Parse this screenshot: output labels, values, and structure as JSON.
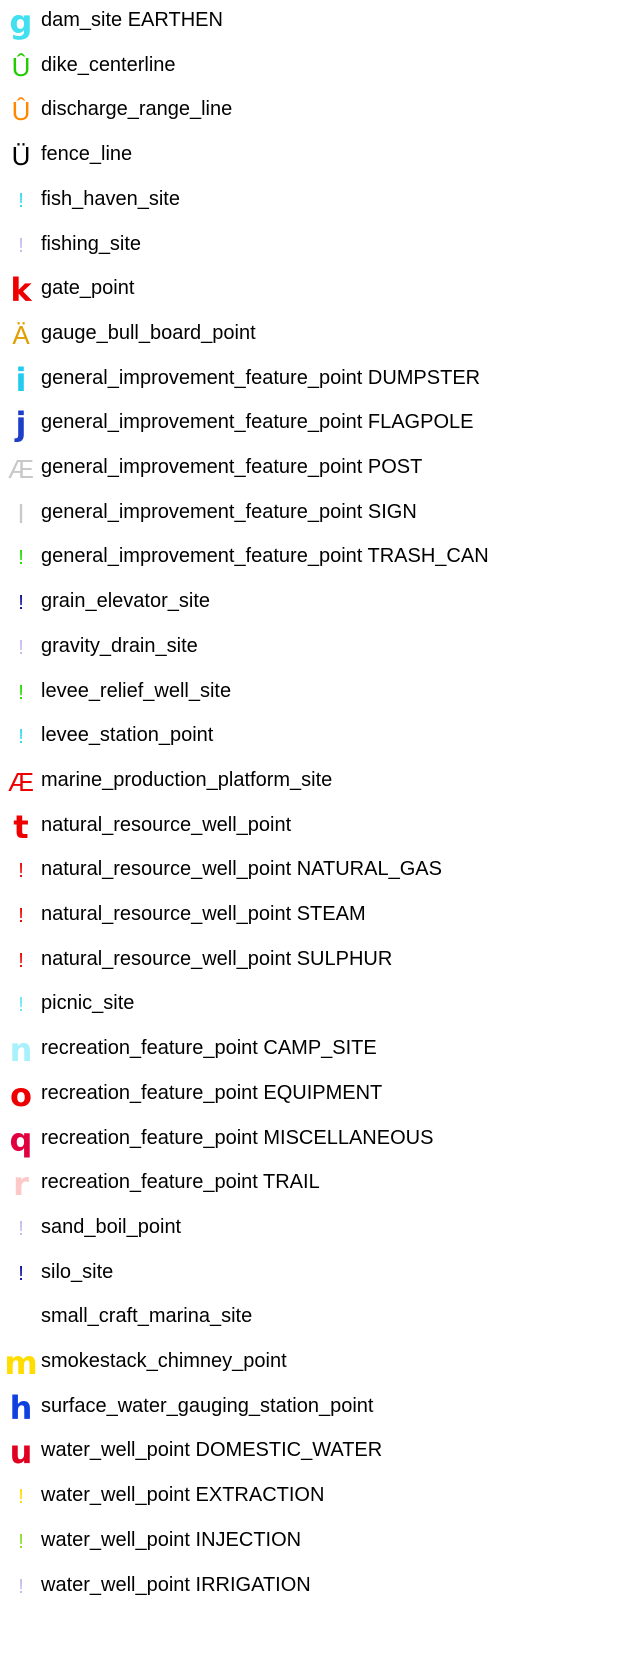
{
  "legend": {
    "items": [
      {
        "symbol": "g",
        "color": "#40e0f0",
        "label": "dam_site EARTHEN"
      },
      {
        "symbol": "Û",
        "color": "#22cc00",
        "label": "dike_centerline"
      },
      {
        "symbol": "Û",
        "color": "#ff8800",
        "label": "discharge_range_line"
      },
      {
        "symbol": "Ü",
        "color": "#000000",
        "label": "fence_line"
      },
      {
        "symbol": "!",
        "color": "#33ddee",
        "label": "fish_haven_site"
      },
      {
        "symbol": "!",
        "color": "#c8b8ee",
        "label": "fishing_site"
      },
      {
        "symbol": "k",
        "color": "#ee0000",
        "label": "gate_point"
      },
      {
        "symbol": "Ä",
        "color": "#e0a000",
        "label": "gauge_bull_board_point"
      },
      {
        "symbol": "i",
        "color": "#22ccee",
        "label": "general_improvement_feature_point DUMPSTER"
      },
      {
        "symbol": "j",
        "color": "#1e3ec8",
        "label": "general_improvement_feature_point FLAGPOLE"
      },
      {
        "symbol": "Æ",
        "color": "#c8c8c8",
        "label": "general_improvement_feature_point POST"
      },
      {
        "symbol": "l",
        "color": "#c8c8c8",
        "label": "general_improvement_feature_point SIGN"
      },
      {
        "symbol": "!",
        "color": "#22dd00",
        "label": "general_improvement_feature_point TRASH_CAN"
      },
      {
        "symbol": "!",
        "color": "#0a0a9c",
        "label": "grain_elevator_site"
      },
      {
        "symbol": "!",
        "color": "#c8b8ee",
        "label": "gravity_drain_site"
      },
      {
        "symbol": "!",
        "color": "#22dd00",
        "label": "levee_relief_well_site"
      },
      {
        "symbol": "!",
        "color": "#33ddee",
        "label": "levee_station_point"
      },
      {
        "symbol": "Æ",
        "color": "#ee0000",
        "label": "marine_production_platform_site"
      },
      {
        "symbol": "t",
        "color": "#ee0000",
        "label": "natural_resource_well_point"
      },
      {
        "symbol": "!",
        "color": "#ee0000",
        "label": "natural_resource_well_point NATURAL_GAS"
      },
      {
        "symbol": "!",
        "color": "#ee0000",
        "label": "natural_resource_well_point STEAM"
      },
      {
        "symbol": "!",
        "color": "#ee0000",
        "label": "natural_resource_well_point SULPHUR"
      },
      {
        "symbol": "!",
        "color": "#66e8f4",
        "label": "picnic_site"
      },
      {
        "symbol": "n",
        "color": "#a8f0fc",
        "label": "recreation_feature_point CAMP_SITE"
      },
      {
        "symbol": "o",
        "color": "#ee0000",
        "label": "recreation_feature_point EQUIPMENT"
      },
      {
        "symbol": "q",
        "color": "#e00040",
        "label": "recreation_feature_point MISCELLANEOUS"
      },
      {
        "symbol": "r",
        "color": "#ffc8c8",
        "label": "recreation_feature_point TRAIL"
      },
      {
        "symbol": "!",
        "color": "#c8b8ee",
        "label": "sand_boil_point"
      },
      {
        "symbol": "!",
        "color": "#0a0a9c",
        "label": "silo_site"
      },
      {
        "symbol": "",
        "color": "#ffffff",
        "label": "small_craft_marina_site"
      },
      {
        "symbol": "m",
        "color": "#ffdd00",
        "label": "smokestack_chimney_point"
      },
      {
        "symbol": "h",
        "color": "#1040e0",
        "label": "surface_water_gauging_station_point"
      },
      {
        "symbol": "u",
        "color": "#e00020",
        "label": "water_well_point DOMESTIC_WATER"
      },
      {
        "symbol": "!",
        "color": "#ffdd00",
        "label": "water_well_point EXTRACTION"
      },
      {
        "symbol": "!",
        "color": "#88dd22",
        "label": "water_well_point INJECTION"
      },
      {
        "symbol": "!",
        "color": "#c8b8ee",
        "label": "water_well_point IRRIGATION"
      }
    ]
  }
}
